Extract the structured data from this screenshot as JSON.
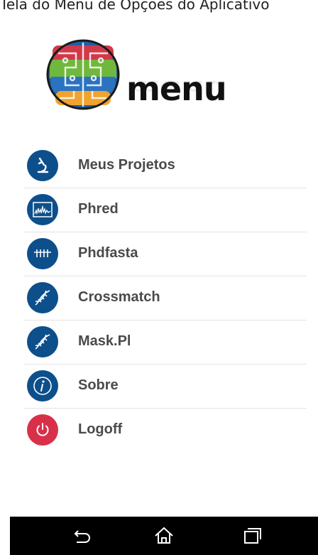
{
  "caption": "Tela do Menu de Opções do Aplicativo",
  "logo": {
    "word": "menu"
  },
  "menu": [
    {
      "label": "Meus Projetos",
      "icon": "microscope-icon"
    },
    {
      "label": "Phred",
      "icon": "chromatogram-icon"
    },
    {
      "label": "Phdfasta",
      "icon": "sequence-icon"
    },
    {
      "label": "Crossmatch",
      "icon": "dna-icon"
    },
    {
      "label": "Mask.Pl",
      "icon": "dna-icon"
    },
    {
      "label": "Sobre",
      "icon": "info-icon"
    },
    {
      "label": "Logoff",
      "icon": "power-icon"
    }
  ],
  "navbar": {
    "buttons": [
      "back-icon",
      "home-icon",
      "recent-apps-icon"
    ]
  },
  "colors": {
    "menu_icon_bg": "#0d4f8b",
    "logoff_icon_bg": "#d9304a",
    "label": "#4a4a4a"
  }
}
